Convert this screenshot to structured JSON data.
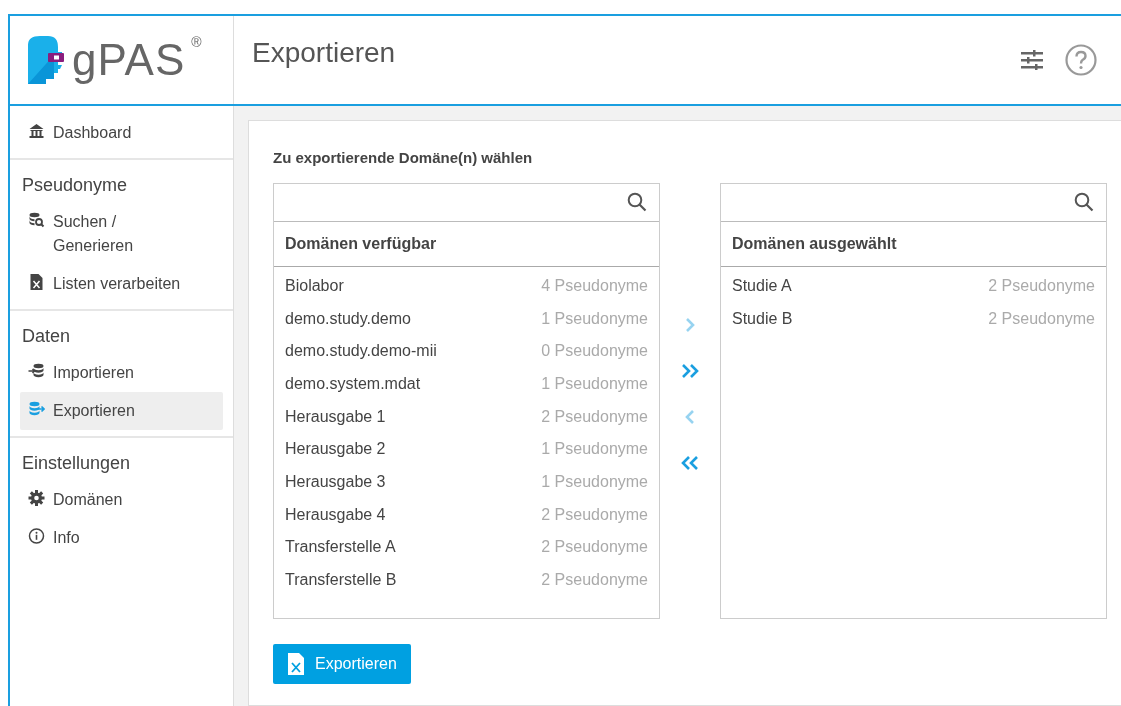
{
  "app": {
    "logo_text": "gPAS",
    "logo_mark": "®"
  },
  "page_title": "Exportieren",
  "sidebar": [
    {
      "kind": "link",
      "label": "Dashboard",
      "selected": false
    },
    {
      "kind": "divider"
    },
    {
      "kind": "heading",
      "label": "Pseudonyme"
    },
    {
      "kind": "link",
      "label": "Suchen / Generieren",
      "selected": false
    },
    {
      "kind": "link",
      "label": "Listen verarbeiten",
      "selected": false
    },
    {
      "kind": "divider"
    },
    {
      "kind": "heading",
      "label": "Daten"
    },
    {
      "kind": "link",
      "label": "Importieren",
      "selected": false
    },
    {
      "kind": "link",
      "label": "Exportieren",
      "selected": true
    },
    {
      "kind": "divider"
    },
    {
      "kind": "heading",
      "label": "Einstellungen"
    },
    {
      "kind": "link",
      "label": "Domänen",
      "selected": false
    },
    {
      "kind": "link",
      "label": "Info",
      "selected": false
    }
  ],
  "section_label": "Zu exportierende Domäne(n) wählen",
  "source": {
    "header": "Domänen verfügbar",
    "items": [
      {
        "name": "Biolabor",
        "count": "4 Pseudonyme"
      },
      {
        "name": "demo.study.demo",
        "count": "1 Pseudonyme"
      },
      {
        "name": "demo.study.demo-mii",
        "count": "0 Pseudonyme"
      },
      {
        "name": "demo.system.mdat",
        "count": "1 Pseudonyme"
      },
      {
        "name": "Herausgabe 1",
        "count": "2 Pseudonyme"
      },
      {
        "name": "Herausgabe 2",
        "count": "1 Pseudonyme"
      },
      {
        "name": "Herausgabe 3",
        "count": "1 Pseudonyme"
      },
      {
        "name": "Herausgabe 4",
        "count": "2 Pseudonyme"
      },
      {
        "name": "Transferstelle A",
        "count": "2 Pseudonyme"
      },
      {
        "name": "Transferstelle B",
        "count": "2 Pseudonyme"
      }
    ]
  },
  "target": {
    "header": "Domänen ausgewählt",
    "items": [
      {
        "name": "Studie A",
        "count": "2 Pseudonyme"
      },
      {
        "name": "Studie B",
        "count": "2 Pseudonyme"
      }
    ]
  },
  "transfer_buttons": [
    {
      "kind": "right",
      "disabled": true
    },
    {
      "kind": "all-right",
      "disabled": false
    },
    {
      "kind": "left",
      "disabled": true
    },
    {
      "kind": "all-left",
      "disabled": false
    }
  ],
  "export_button": {
    "label": "Exportieren"
  }
}
